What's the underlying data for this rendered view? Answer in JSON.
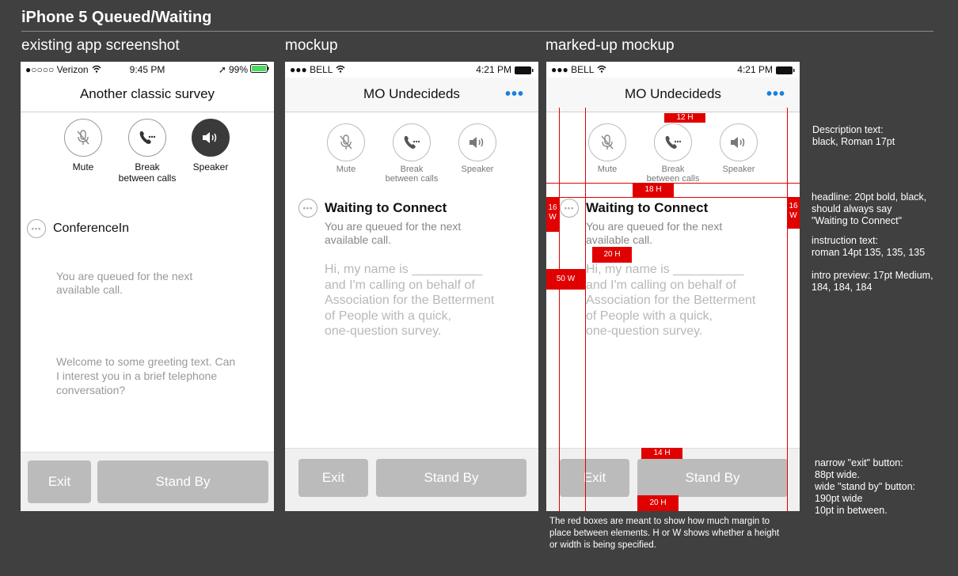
{
  "page_title": "iPhone 5 Queued/Waiting",
  "columns": {
    "existing": "existing app screenshot",
    "mockup": "mockup",
    "marked": "marked-up mockup"
  },
  "existing": {
    "carrier": "●○○○○ Verizon",
    "time": "9:45 PM",
    "battery": "99%",
    "nav_title": "Another classic survey",
    "controls": [
      "Mute",
      "Break\nbetween calls",
      "Speaker"
    ],
    "conference": "ConferenceIn",
    "queued": "You are queued for the next available call.",
    "greeting": "Welcome to some greeting text. Can I interest you in a brief telephone conversation?",
    "exit": "Exit",
    "standby": "Stand By"
  },
  "mockup": {
    "carrier": "●●● BELL",
    "time": "4:21 PM",
    "nav_title": "MO Undecideds",
    "nav_dots": "•••",
    "controls": [
      "Mute",
      "Break\nbetween calls",
      "Speaker"
    ],
    "headline": "Waiting to Connect",
    "instruction": "You are queued for the next available call.",
    "intro": "Hi, my name is __________\nand I'm calling on behalf of\nAssociation for the Betterment\nof People with a quick,\none-question survey.",
    "exit": "Exit",
    "standby": "Stand By"
  },
  "markup": {
    "labels": {
      "top12": "12 H",
      "gap18": "18 H",
      "left16": "16 W",
      "right16": "16 W",
      "gap20": "20 H",
      "w50": "50 W",
      "h14": "14 H",
      "h20b": "20 H"
    },
    "caption": "The red boxes are meant to show how much margin to place between elements. H or W shows whether a height or width is being specified."
  },
  "notes": {
    "desc": "Description text:\nblack, Roman 17pt",
    "headline": "headline: 20pt bold, black,\nshould always say\n\"Waiting to Connect\"",
    "instruction": "instruction text:\nroman 14pt 135, 135, 135",
    "intro": "intro preview: 17pt Medium,\n184, 184, 184",
    "buttons": "narrow \"exit\" button:\n88pt wide.\nwide \"stand by\" button:\n190pt wide\n10pt in between."
  },
  "colors": {
    "accent": "#1a7fe0",
    "markup": "#e00000",
    "button": "#bbbbbb",
    "background": "#404040"
  }
}
